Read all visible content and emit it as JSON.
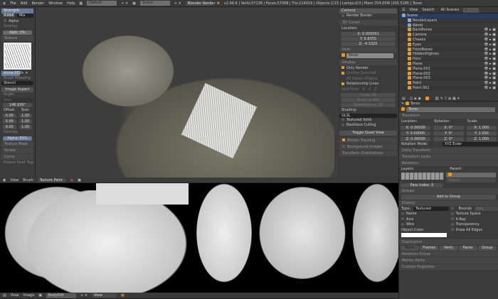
{
  "topbar": {
    "menus": [
      "File",
      "Add",
      "Render",
      "Window",
      "Help"
    ],
    "layout": "Default",
    "scene": "Scene",
    "engine": "Blender Render",
    "stats": "v2.66.6 | Verts:57136 | Faces:57008 | Tris:114016 | Objects:1/15 | Lamps:0/3 | Mem:704.05M (105.51M) | Torso"
  },
  "tool_panel": {
    "strength": "Strength: 0.216",
    "blend_label": "Blend:",
    "blend": "Mix",
    "alpha": "Alpha",
    "overlay_label": "Overlay:",
    "overlay_alpha": "Alph: 1%",
    "texture_section": "Texture",
    "texture_name": "alune.002",
    "brush_mapping_label": "Brush Mapping:",
    "brush_mapping": "Stencil",
    "image_aspect": "Image Aspect",
    "angle_label": "Angle:",
    "angle_mode": "User",
    "angle": "146.936°",
    "offset_label": "Offset:",
    "size_label": "Size:",
    "offsets": [
      "0.00",
      "0.00",
      "0.00"
    ],
    "sizes": [
      "1.00",
      "1.00",
      "1.00"
    ],
    "overlay2_label": "Overlay:",
    "overlay2_alpha": "Alpha: 65%",
    "texture_mask": "Texture Mask",
    "stroke": "Stroke",
    "curve": "Curve",
    "project_paint": "Project Paint Toggle"
  },
  "n_panel": {
    "camera": "Camera",
    "render_border": "Render Border",
    "cursor_section": "3D Cursor",
    "location_label": "Location:",
    "cursor": [
      "X: 0.000001",
      "Y: 6.8355",
      "Z: -4.3325"
    ],
    "item_section": "Item",
    "item_name": "Torso",
    "display_section": "Display",
    "only_render": "Only Render",
    "outline_selected": "Outline Selected",
    "all_origins": "All Object Origins",
    "relationship_lines": "Relationship Lines",
    "grid_floor": "Grid Floor",
    "axes": [
      "X",
      "Y",
      "Z"
    ],
    "lines": "Lines: 16",
    "scale": "Scale: 1.000",
    "subdivisions": "Subdivisions: 10",
    "shading_label": "Shading:",
    "shading": "GLSL",
    "textured_solid": "Textured Solid",
    "backface_culling": "Backface Culling",
    "toggle_quad": "Toggle Quad View",
    "motion_tracking": "Motion Tracking",
    "background_images": "Background Images",
    "transform_orientations": "Transform Orientations"
  },
  "view3d_header": {
    "menus": [
      "View",
      "Brush"
    ],
    "mode": "Texture Paint"
  },
  "image_header": {
    "menus": [
      "View",
      "Image"
    ],
    "image": "BodyDiff",
    "view": "View"
  },
  "outliner": {
    "menus": [
      "View",
      "Search"
    ],
    "filter": "All Scenes",
    "items": [
      {
        "name": "Scene",
        "depth": 0,
        "kind": "scene"
      },
      {
        "name": "RenderLayers",
        "depth": 1,
        "kind": "render"
      },
      {
        "name": "World",
        "depth": 1,
        "kind": "world"
      },
      {
        "name": "BackBones",
        "depth": 1,
        "kind": "mesh"
      },
      {
        "name": "Camera",
        "depth": 1,
        "kind": "camera"
      },
      {
        "name": "Cheeks",
        "depth": 1,
        "kind": "mesh"
      },
      {
        "name": "Eyes",
        "depth": 1,
        "kind": "mesh"
      },
      {
        "name": "FrontBones",
        "depth": 1,
        "kind": "mesh"
      },
      {
        "name": "HiddenHighres",
        "depth": 1,
        "kind": "mesh"
      },
      {
        "name": "Horn",
        "depth": 1,
        "kind": "mesh"
      },
      {
        "name": "Plane",
        "depth": 1,
        "kind": "mesh"
      },
      {
        "name": "Plane.001",
        "depth": 1,
        "kind": "mesh"
      },
      {
        "name": "Plane.002",
        "depth": 1,
        "kind": "mesh"
      },
      {
        "name": "Plane.003",
        "depth": 1,
        "kind": "mesh"
      },
      {
        "name": "Point",
        "depth": 1,
        "kind": "lamp"
      },
      {
        "name": "Point.001",
        "depth": 1,
        "kind": "lamp"
      }
    ]
  },
  "properties": {
    "object": "Torso",
    "name": "Torso",
    "transform": "Transform",
    "location_label": "Location:",
    "rotation_label": "Rotation:",
    "scale_label": "Scale:",
    "location": [
      "X: 0.00000",
      "Y: 0.00000",
      "Z: 0.00000"
    ],
    "rotation": [
      "X: 0°",
      "Y: 0°",
      "Z: 0°"
    ],
    "scale": [
      "X: 1.000",
      "Y: 1.000",
      "Z: 1.000"
    ],
    "rotation_mode_label": "Rotation Mode:",
    "rotation_mode": "XYZ Euler",
    "delta": "Delta Transform",
    "locks": "Transform Locks",
    "relations": "Relations",
    "layers_label": "Layers:",
    "parent_label": "Parent:",
    "parent_type": "Object",
    "pass_index": "Pass Index: 0",
    "groups": "Groups",
    "add_group": "Add to Group",
    "display": "Display",
    "type_label": "Type:",
    "type": "Textured",
    "bounds": "Bounds",
    "bounds_type": "Box",
    "name_cb": "Name",
    "texture_space": "Texture Space",
    "axis": "Axis",
    "xray": "X-Ray",
    "wire": "Wire",
    "transparency": "Transparency",
    "object_color": "Object Color:",
    "draw_all_edges": "Draw All Edges",
    "duplication": "Duplication",
    "dup_options": [
      "None",
      "Frames",
      "Verts",
      "Faces",
      "Group"
    ],
    "relations_extras": "Relations Extras",
    "motion_paths": "Motion Paths",
    "custom_props": "Custom Properties"
  },
  "colors": {
    "accent": "#e79a2a",
    "selected_row": "#2a3b63"
  }
}
